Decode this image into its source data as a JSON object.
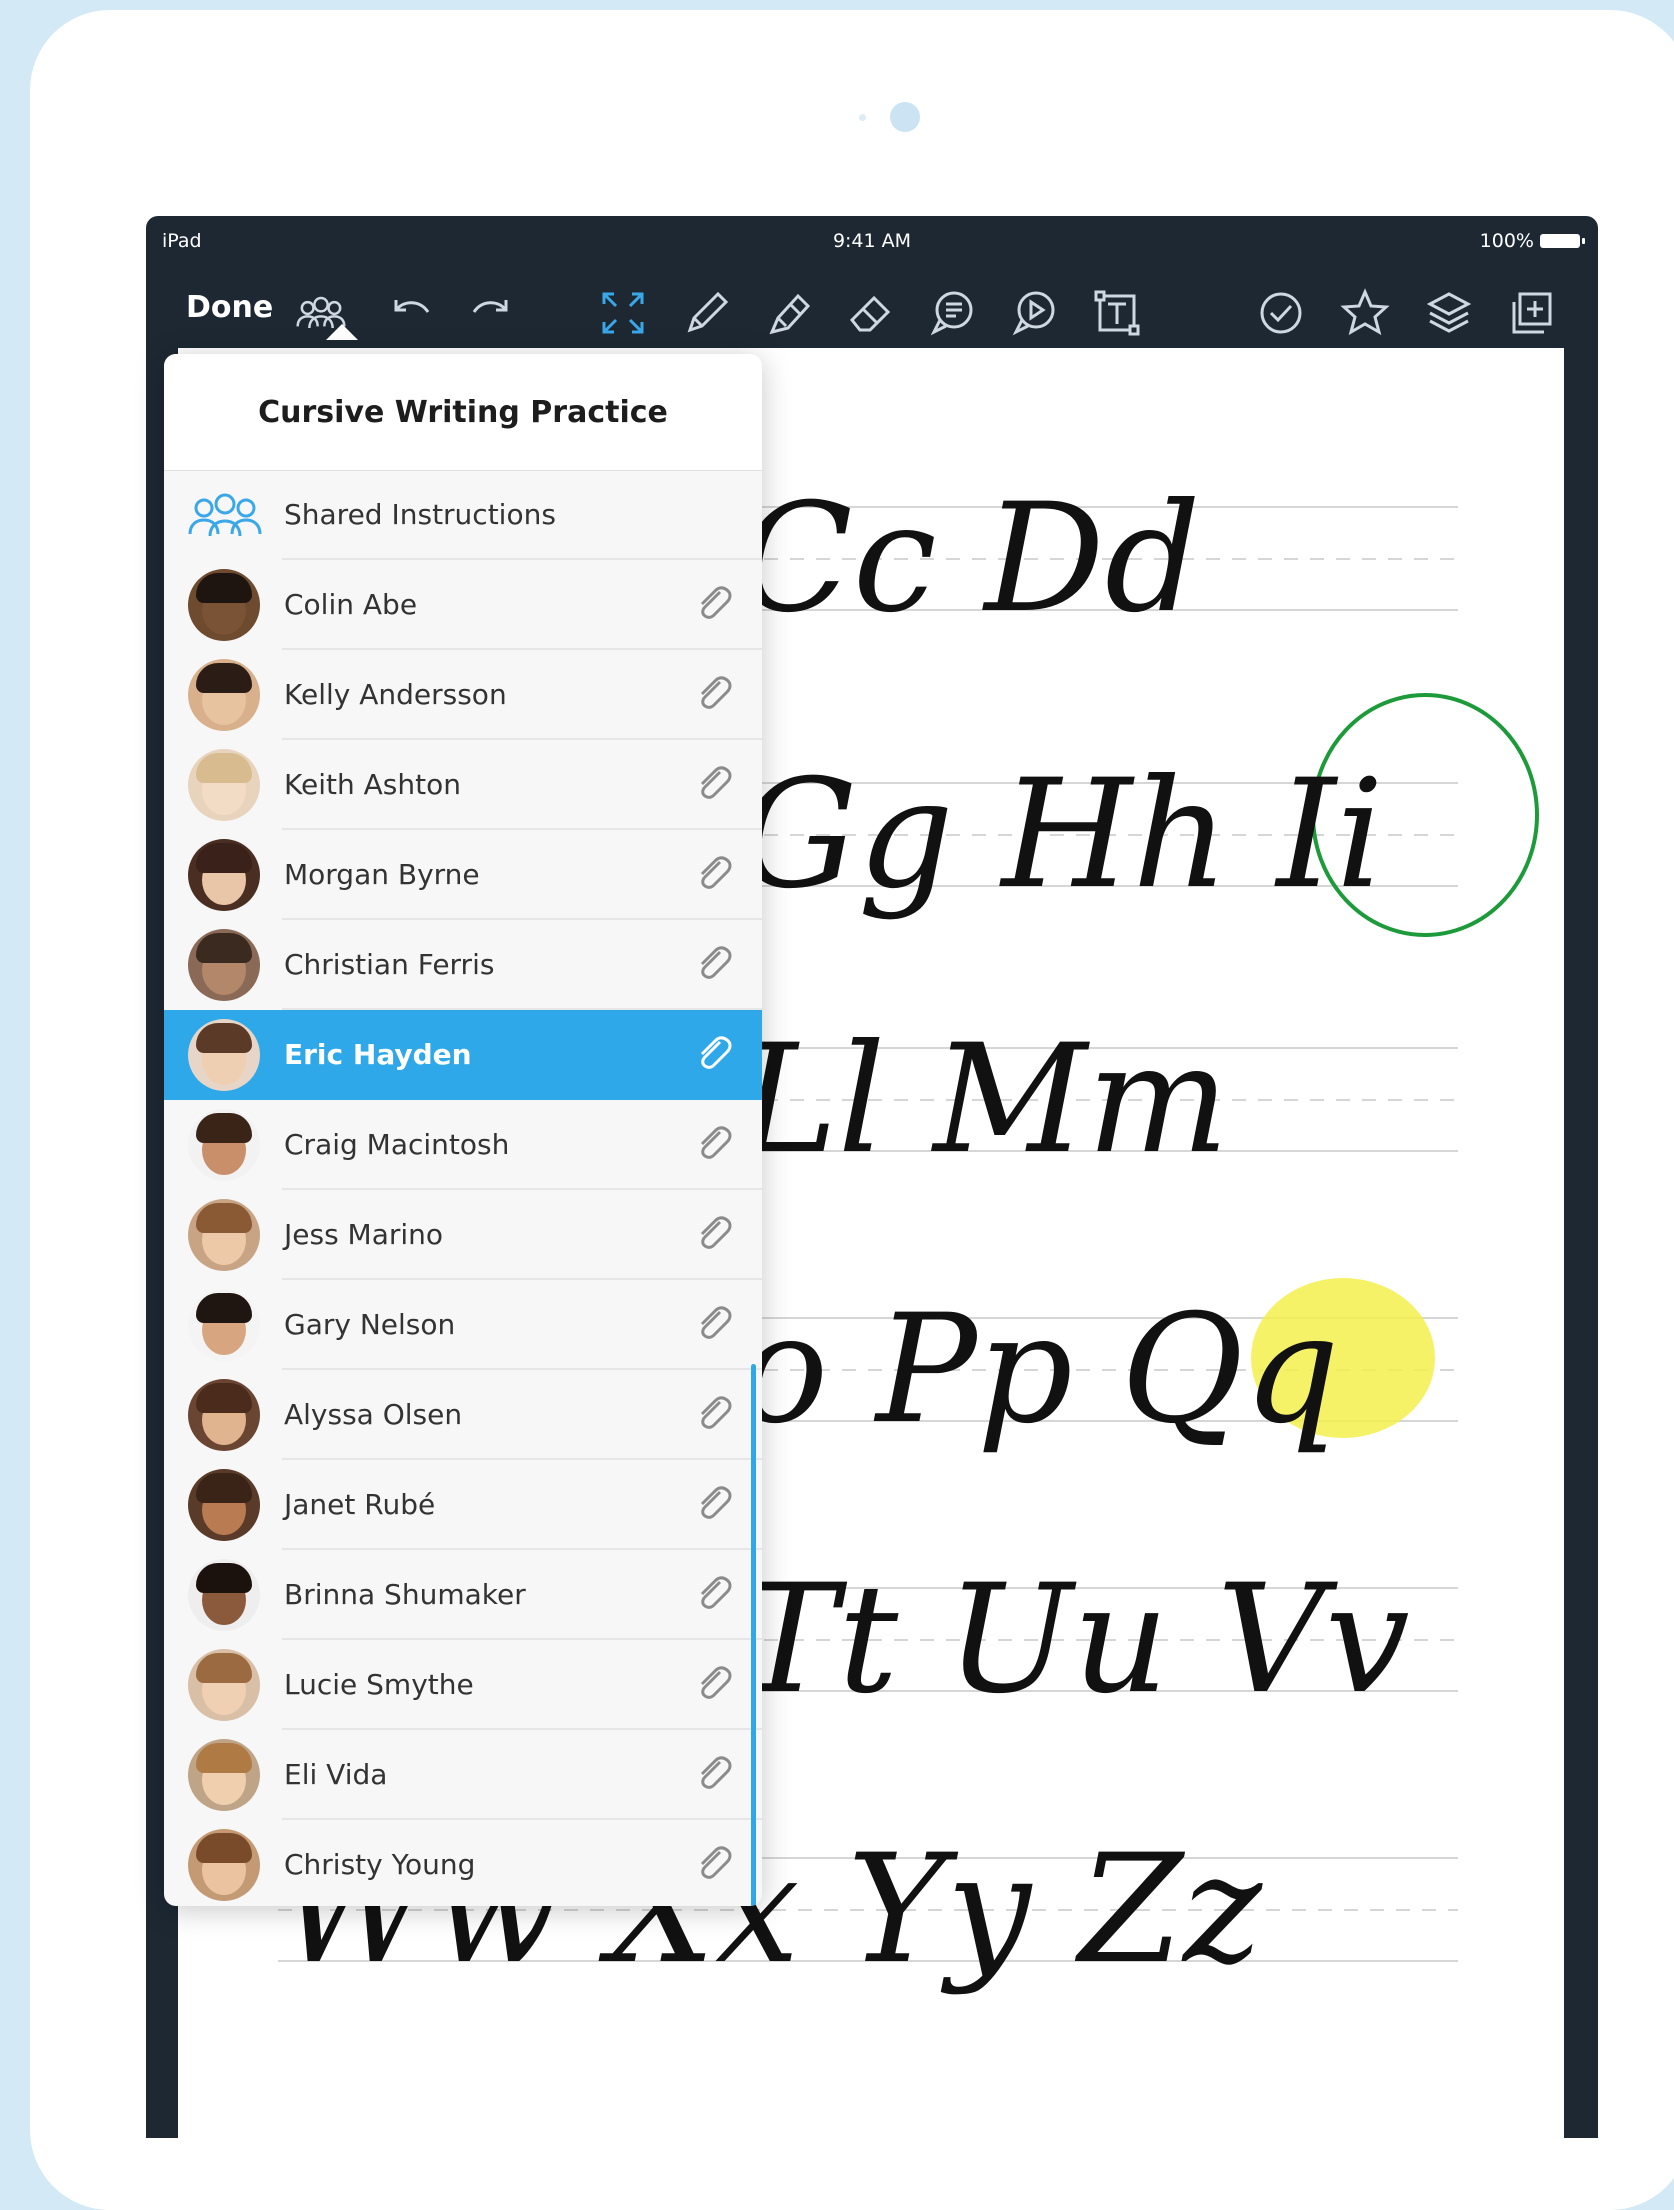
{
  "status_bar": {
    "device": "iPad",
    "time": "9:41 AM",
    "battery": "100%"
  },
  "toolbar": {
    "done_label": "Done",
    "tools": [
      "students-icon",
      "undo-icon",
      "redo-icon",
      "fullscreen-icon",
      "pen-icon",
      "highlighter-icon",
      "eraser-icon",
      "comment-icon",
      "audio-icon",
      "text-box-icon",
      "check-icon",
      "star-icon",
      "layers-icon",
      "add-page-icon"
    ],
    "pen_color": "#2fb34a",
    "highlighter_color": "#f2e84a"
  },
  "popover": {
    "title": "Cursive Writing Practice",
    "shared_label": "Shared Instructions",
    "students": [
      {
        "name": "Colin Abe"
      },
      {
        "name": "Kelly Andersson"
      },
      {
        "name": "Keith Ashton"
      },
      {
        "name": "Morgan Byrne"
      },
      {
        "name": "Christian Ferris"
      },
      {
        "name": "Eric Hayden",
        "selected": true
      },
      {
        "name": "Craig Macintosh"
      },
      {
        "name": "Jess Marino"
      },
      {
        "name": "Gary Nelson"
      },
      {
        "name": "Alyssa Olsen"
      },
      {
        "name": "Janet Rubé"
      },
      {
        "name": "Brinna Shumaker"
      },
      {
        "name": "Lucie Smythe"
      },
      {
        "name": "Eli Vida"
      },
      {
        "name": "Christy Young"
      }
    ]
  },
  "worksheet": {
    "rows": [
      "Cc Dd",
      "Gg Hh Ii",
      "Ll Mm",
      "o Pp Qq",
      "Tt Uu Vv",
      "Ww Xx Yy Zz"
    ],
    "accent": "#1d9a3a",
    "highlight": "#f4f04e"
  },
  "colors": {
    "selection": "#2fa8ea",
    "toolbar": "#1d2833",
    "backdrop": "#d3e9f5"
  }
}
